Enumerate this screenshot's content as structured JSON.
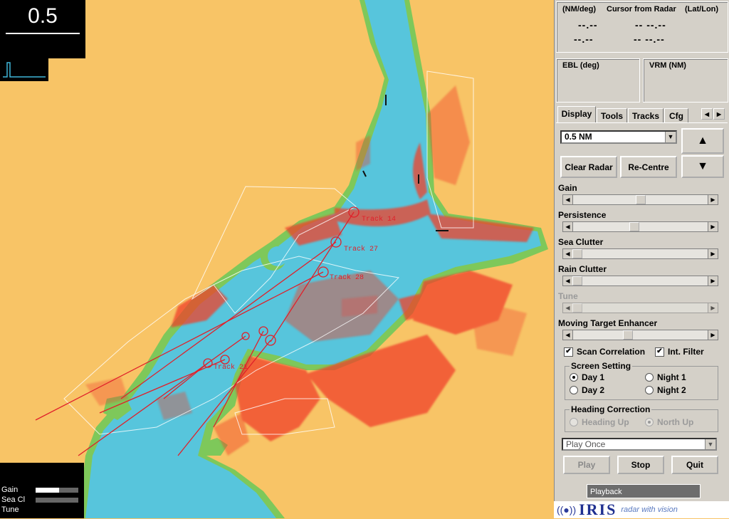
{
  "radar": {
    "range": "0.5",
    "gain_label": "Gain",
    "sea_label": "Sea Cl",
    "tune_label": "Tune",
    "gain_level": 0.55,
    "sea_level": 0.0,
    "tune_level": 0.0,
    "track_labels": [
      "Track 14",
      "Track 27",
      "Track 28",
      "Track 21"
    ],
    "colors": {
      "land": "#f8c466",
      "shore": "#7ec85a",
      "water": "#57c5dc",
      "echo": "#f0402a"
    }
  },
  "readout": {
    "title_left": "(NM/deg)",
    "title_mid": "Cursor from Radar",
    "title_right": "(Lat/Lon)",
    "range_value": "--.--",
    "bearing_value": "--.--",
    "lat_value": "-- --.--",
    "lon_value": "-- --.--"
  },
  "ebl_label": "EBL (deg)",
  "vrm_label": "VRM (NM)",
  "tabs": [
    "Display",
    "Tools",
    "Tracks",
    "Cfg"
  ],
  "display": {
    "range_select": "0.5    NM",
    "clear_radar": "Clear Radar",
    "re_centre": "Re-Centre",
    "sliders": [
      {
        "label": "Gain",
        "value": 0.5,
        "enabled": true
      },
      {
        "label": "Persistence",
        "value": 0.45,
        "enabled": true
      },
      {
        "label": "Sea Clutter",
        "value": 0.0,
        "enabled": true
      },
      {
        "label": "Rain Clutter",
        "value": 0.0,
        "enabled": true
      },
      {
        "label": "Tune",
        "value": 0.0,
        "enabled": false
      },
      {
        "label": "Moving Target Enhancer",
        "value": 0.4,
        "enabled": true
      }
    ],
    "scan_correlation": "Scan Correlation",
    "int_filter": "Int. Filter",
    "screen_setting": "Screen Setting",
    "day1": "Day 1",
    "day2": "Day 2",
    "night1": "Night 1",
    "night2": "Night 2",
    "heading_correction": "Heading Correction",
    "heading_up": "Heading Up",
    "north_up": "North Up",
    "playback_mode": "Play Once",
    "play": "Play",
    "stop": "Stop",
    "quit": "Quit",
    "tooltip": "Playback"
  },
  "logo": {
    "name": "IRIS",
    "tagline": "radar with vision"
  }
}
